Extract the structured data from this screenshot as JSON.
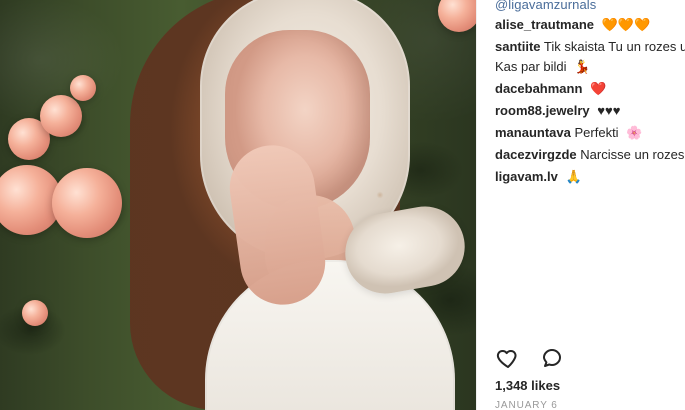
{
  "post": {
    "handle_top": "@ligavamzurnals",
    "comments": [
      {
        "user": "alise_trautmane",
        "text": "",
        "emoji": "🧡🧡🧡"
      },
      {
        "user": "santiite",
        "text": "Tik skaista Tu un rozes u",
        "emoji": ""
      },
      {
        "user": "",
        "text": "Kas par bildi",
        "emoji": "💃"
      },
      {
        "user": "dacebahmann",
        "text": "",
        "emoji": "❤️"
      },
      {
        "user": "room88.jewelry",
        "text": "",
        "emoji": "♥♥♥"
      },
      {
        "user": "manauntava",
        "text": "Perfekti",
        "emoji": "🌸"
      },
      {
        "user": "dacezvirgzde",
        "text": "Narcisse un rozes",
        "emoji": ""
      },
      {
        "user": "ligavam.lv",
        "text": "",
        "emoji": "🙏"
      }
    ],
    "actions": {
      "like_icon": "heart-outline-icon",
      "comment_icon": "comment-outline-icon"
    },
    "likes_label": "1,348 likes",
    "date_label": "JANUARY 6"
  }
}
